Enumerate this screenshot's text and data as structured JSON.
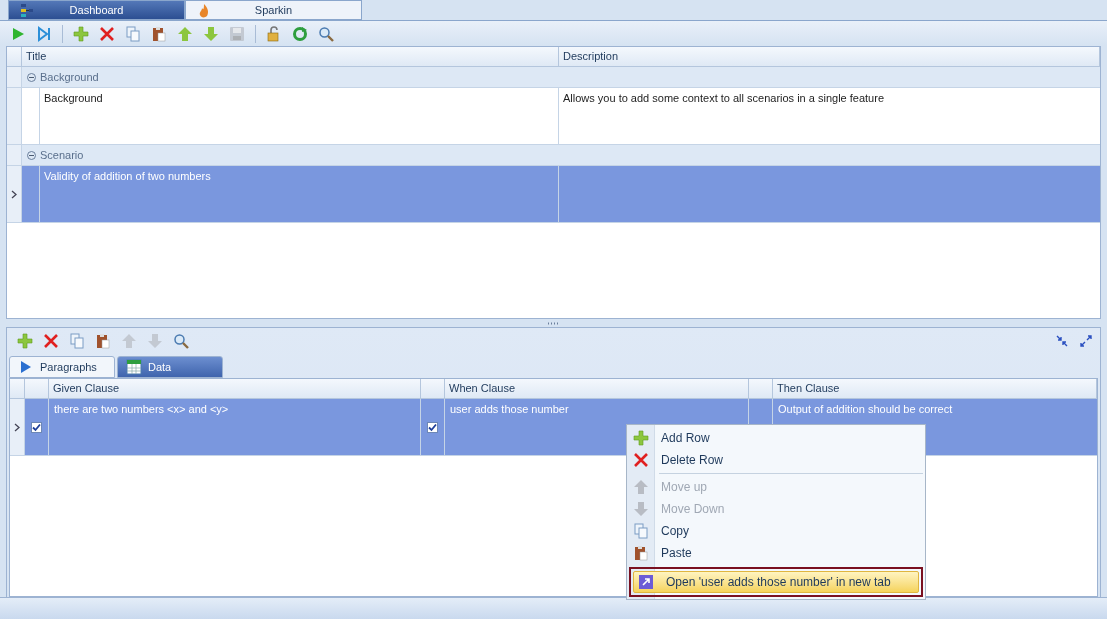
{
  "top_tabs": [
    {
      "label": "Dashboard",
      "selected": false
    },
    {
      "label": "Sparkin",
      "selected": true
    }
  ],
  "toolbar": [
    {
      "kind": "run",
      "disabled": false
    },
    {
      "kind": "step",
      "disabled": false
    },
    {
      "kind": "sep"
    },
    {
      "kind": "add",
      "disabled": false
    },
    {
      "kind": "delete",
      "disabled": false
    },
    {
      "kind": "copy",
      "disabled": false
    },
    {
      "kind": "paste",
      "disabled": false
    },
    {
      "kind": "up",
      "disabled": false
    },
    {
      "kind": "down",
      "disabled": false
    },
    {
      "kind": "save",
      "disabled": true
    },
    {
      "kind": "sep"
    },
    {
      "kind": "lock",
      "disabled": false
    },
    {
      "kind": "refresh",
      "disabled": false
    },
    {
      "kind": "search",
      "disabled": false
    }
  ],
  "feature_grid": {
    "columns": [
      "Title",
      "Description"
    ],
    "groups": [
      {
        "label": "Background",
        "expanded": true,
        "rows": [
          {
            "title": "Background",
            "description": "Allows you to add some context to all scenarios in a single feature",
            "selected": false
          }
        ]
      },
      {
        "label": "Scenario",
        "expanded": true,
        "rows": [
          {
            "title": "Validity of addition of two numbers",
            "selected": true
          }
        ]
      }
    ]
  },
  "lower_toolbar": [
    {
      "kind": "add",
      "disabled": false
    },
    {
      "kind": "delete",
      "disabled": false
    },
    {
      "kind": "copy",
      "disabled": false
    },
    {
      "kind": "paste",
      "disabled": false
    },
    {
      "kind": "up",
      "disabled": true
    },
    {
      "kind": "down",
      "disabled": true
    },
    {
      "kind": "search",
      "disabled": false
    }
  ],
  "lower_tabs": [
    {
      "label": "Paragraphs",
      "selected": true
    },
    {
      "label": "Data",
      "selected": false
    }
  ],
  "steps_grid": {
    "columns": [
      "Given Clause",
      "When Clause",
      "Then Clause"
    ],
    "rows": [
      {
        "given": "there are two numbers <x> and <y>",
        "given_checked": true,
        "when": "user adds those number",
        "when_checked": true,
        "then": "Output of addition should be correct",
        "selected": true
      }
    ]
  },
  "context_menu": [
    {
      "kind": "add",
      "label": "Add Row",
      "disabled": false,
      "selected": false
    },
    {
      "kind": "delete",
      "label": "Delete Row",
      "disabled": false,
      "selected": false
    },
    {
      "kind": "separator"
    },
    {
      "kind": "up",
      "label": "Move up",
      "disabled": true,
      "selected": false
    },
    {
      "kind": "down",
      "label": "Move Down",
      "disabled": true,
      "selected": false
    },
    {
      "kind": "copy",
      "label": "Copy",
      "disabled": false,
      "selected": false
    },
    {
      "kind": "paste",
      "label": "Paste",
      "disabled": false,
      "selected": false
    },
    {
      "kind": "open",
      "label": "Open 'user adds those number' in new tab",
      "disabled": false,
      "selected": true
    }
  ]
}
